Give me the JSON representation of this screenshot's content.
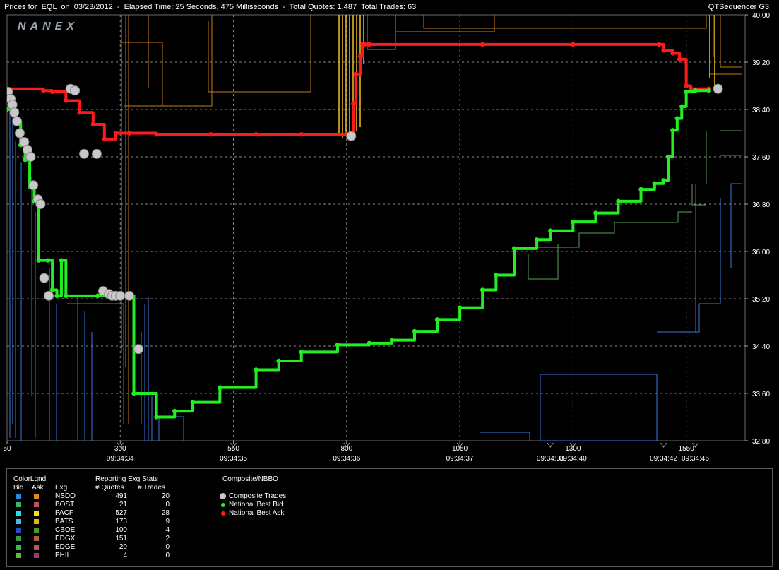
{
  "header": {
    "prices_for_label": "Prices for",
    "symbol": "EQL",
    "on_label": "on",
    "date": "03/23/2012",
    "elapsed_label": "Elapsed Time:",
    "elapsed_value": "25 Seconds, 475 Milliseconds",
    "total_quotes_label": "Total Quotes:",
    "total_quotes_value": "1,487",
    "total_trades_label": "Total Trades:",
    "total_trades_value": "63",
    "app_name": "QTSequencer G3"
  },
  "watermark": "NANEX",
  "colors": {
    "background": "#000000",
    "grid": "#8a8a8a",
    "composite_trades": "#c8c8c8",
    "national_best_bid": "#22ee22",
    "national_best_ask": "#ff1a1a"
  },
  "chart_data": {
    "type": "line",
    "title": "",
    "xlabel": "",
    "ylabel": "",
    "ylim": [
      32.8,
      40.0
    ],
    "xlim": [
      50,
      1680
    ],
    "y_ticks": [
      "40.00",
      "39.20",
      "38.40",
      "37.60",
      "36.80",
      "36.00",
      "35.20",
      "34.40",
      "33.60",
      "32.80"
    ],
    "y_tick_values": [
      40.0,
      39.2,
      38.4,
      37.6,
      36.8,
      36.0,
      35.2,
      34.4,
      33.6,
      32.8
    ],
    "x_ticks": [
      "50",
      "300",
      "550",
      "800",
      "1050",
      "1300",
      "1550"
    ],
    "x_tick_values": [
      50,
      300,
      550,
      800,
      1050,
      1300,
      1550
    ],
    "time_labels": [
      {
        "seq": 300,
        "label": "09:34:34"
      },
      {
        "seq": 550,
        "label": "09:34:35"
      },
      {
        "seq": 800,
        "label": "09:34:36"
      },
      {
        "seq": 1050,
        "label": "09:34:37"
      },
      {
        "seq": 1250,
        "label": "09:34:38"
      },
      {
        "seq": 1300,
        "label": "09:34:40"
      },
      {
        "seq": 1500,
        "label": "09:34:42"
      },
      {
        "seq": 1570,
        "label": "09:34:46"
      }
    ],
    "grid": true,
    "legend_position": "bottom-left",
    "series": [
      {
        "name": "National Best Ask",
        "color": "#ff1a1a",
        "x": [
          50,
          130,
          150,
          180,
          210,
          240,
          265,
          290,
          320,
          380,
          500,
          600,
          700,
          800,
          815,
          820,
          830,
          835,
          840,
          850,
          1100,
          1300,
          1490,
          1500,
          1520,
          1535,
          1550,
          1560,
          1600
        ],
        "y": [
          38.75,
          38.72,
          38.7,
          38.55,
          38.35,
          38.15,
          37.9,
          38.0,
          38.0,
          37.98,
          37.98,
          37.98,
          37.98,
          37.98,
          38.5,
          39.0,
          39.3,
          39.5,
          39.5,
          39.5,
          39.5,
          39.5,
          39.5,
          39.4,
          39.35,
          39.25,
          38.8,
          38.75,
          38.75
        ]
      },
      {
        "name": "National Best Bid",
        "color": "#22ee22",
        "x": [
          50,
          70,
          80,
          90,
          100,
          110,
          120,
          140,
          150,
          160,
          170,
          180,
          250,
          300,
          330,
          380,
          420,
          460,
          520,
          600,
          650,
          700,
          780,
          850,
          900,
          950,
          1000,
          1050,
          1100,
          1130,
          1170,
          1220,
          1250,
          1300,
          1350,
          1400,
          1450,
          1480,
          1500,
          1510,
          1520,
          1530,
          1540,
          1550,
          1570,
          1600
        ],
        "y": [
          38.4,
          38.2,
          37.8,
          37.55,
          37.1,
          36.85,
          35.85,
          35.85,
          35.35,
          35.25,
          35.85,
          35.25,
          35.25,
          35.25,
          33.6,
          33.2,
          33.3,
          33.45,
          33.7,
          34.0,
          34.15,
          34.3,
          34.42,
          34.45,
          34.5,
          34.65,
          34.85,
          35.05,
          35.35,
          35.6,
          36.05,
          36.2,
          36.35,
          36.5,
          36.65,
          36.85,
          37.05,
          37.15,
          37.2,
          37.6,
          38.05,
          38.25,
          38.45,
          38.7,
          38.72,
          38.72
        ]
      }
    ],
    "composite_trades": {
      "name": "Composite Trades",
      "x": [
        52,
        58,
        62,
        66,
        72,
        78,
        88,
        95,
        102,
        108,
        118,
        124,
        132,
        142,
        190,
        200,
        220,
        248,
        262,
        275,
        282,
        290,
        300,
        320,
        340,
        810,
        1620
      ],
      "y": [
        38.7,
        38.58,
        38.48,
        38.35,
        38.2,
        38.0,
        37.85,
        37.72,
        37.6,
        37.12,
        36.88,
        36.8,
        35.55,
        35.25,
        38.75,
        38.72,
        37.65,
        37.65,
        35.33,
        35.28,
        35.25,
        35.25,
        35.25,
        35.25,
        34.35,
        37.95,
        38.75
      ]
    }
  },
  "legend": {
    "color_legend_title": "ColorLgnd",
    "bid_label": "Bid",
    "ask_label": "Ask",
    "stats_title": "Reporting Exg Stats",
    "exg_label": "Exg",
    "quotes_label": "# Quotes",
    "trades_label": "# Trades",
    "composite_title": "Composite/NBBO",
    "exchanges": [
      {
        "exg": "NSDQ",
        "quotes": "491",
        "trades": "20",
        "bid_color": "#2a8ae0",
        "ask_color": "#e08a1a"
      },
      {
        "exg": "BOST",
        "quotes": "21",
        "trades": "0",
        "bid_color": "#3cb46e",
        "ask_color": "#c0506e"
      },
      {
        "exg": "PACF",
        "quotes": "527",
        "trades": "28",
        "bid_color": "#1ae6e6",
        "ask_color": "#f0e01a"
      },
      {
        "exg": "BATS",
        "quotes": "173",
        "trades": "9",
        "bid_color": "#50b4f0",
        "ask_color": "#e0b41a"
      },
      {
        "exg": "CBOE",
        "quotes": "100",
        "trades": "4",
        "bid_color": "#2a4ac8",
        "ask_color": "#4a9a2a"
      },
      {
        "exg": "EDGX",
        "quotes": "151",
        "trades": "2",
        "bid_color": "#3a9a4a",
        "ask_color": "#b06040"
      },
      {
        "exg": "EDGE",
        "quotes": "20",
        "trades": "0",
        "bid_color": "#3cb45a",
        "ask_color": "#b05a5a"
      },
      {
        "exg": "PHIL",
        "quotes": "4",
        "trades": "0",
        "bid_color": "#6ab43c",
        "ask_color": "#a03a6e"
      }
    ],
    "composite_items": [
      {
        "label": "Composite Trades",
        "color": "#c8c8c8"
      },
      {
        "label": "National Best Bid",
        "color": "#22ee22"
      },
      {
        "label": "National Best Ask",
        "color": "#ff1a1a"
      }
    ]
  }
}
